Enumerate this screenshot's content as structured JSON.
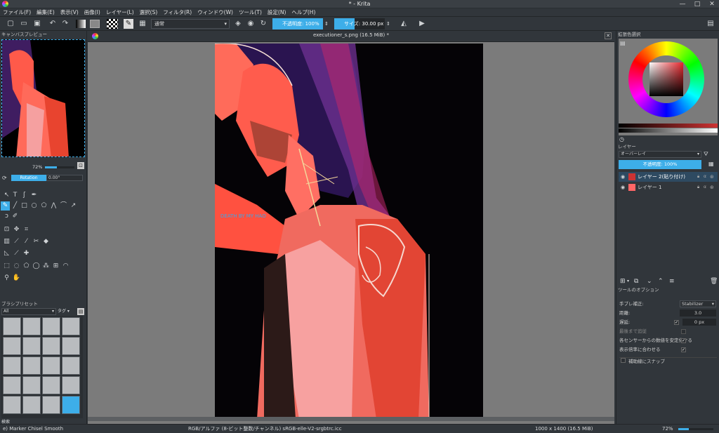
{
  "window": {
    "title": "* - Krita",
    "minimize": "—",
    "maximize": "□",
    "close": "✕"
  },
  "menu": [
    "ファイル(F)",
    "編集(E)",
    "表示(V)",
    "画像(I)",
    "レイヤー(L)",
    "選択(S)",
    "フィルタ(R)",
    "ウィンドウ(W)",
    "ツール(T)",
    "設定(N)",
    "ヘルプ(H)"
  ],
  "toolbar": {
    "blend_mode": "通常",
    "opacity_label": "不透明度: 100%",
    "size_label": "サイズ: 30.00 px"
  },
  "document": {
    "tab_title": "executioner_s.png (16.5 MiB) *",
    "signature": "DEATH BY MY HAO"
  },
  "left": {
    "preview_title": "キャンバスプレビュー",
    "zoom": "72%",
    "rotation": "Rotation",
    "rotation_value": "0.00°",
    "brush_presets_title": "ブラシプリセット",
    "filter_all": "All",
    "tag_label": "タグ",
    "search_label": "検索"
  },
  "right": {
    "color_title": "拡張色選択",
    "layers_title": "レイヤー",
    "layer_blend": "オーバーレイ",
    "layer_opacity": "不透明度: 100%",
    "layers": [
      {
        "name": "レイヤー 2(貼り付け)",
        "selected": true
      },
      {
        "name": "レイヤー 1",
        "selected": false
      }
    ],
    "tool_options_title": "ツールのオプション",
    "smoothing_label": "手ブレ補正:",
    "smoothing_value": "Stabilizer",
    "distance_label": "距離:",
    "distance_value": "3.0",
    "delay_label": "遅延:",
    "delay_value": "0 px",
    "finish_label": "最後まで追従",
    "stabilize_label": "各センサーからの数値を安定化する",
    "scale_label": "表示倍率に合わせる",
    "snap_label": "補助線にスナップ"
  },
  "status": {
    "brush": "e) Marker Chisel Smooth",
    "colorspace": "RGB/アルファ (8-ビット整数/チャンネル)  sRGB-elle-V2-srgbtrc.icc",
    "dimensions": "1000 x 1400 (16.5 MiB)",
    "zoom": "72%"
  },
  "colors": {
    "accent": "#3daee9",
    "bg": "#31363b",
    "canvas_bg": "#7b7b7b"
  }
}
